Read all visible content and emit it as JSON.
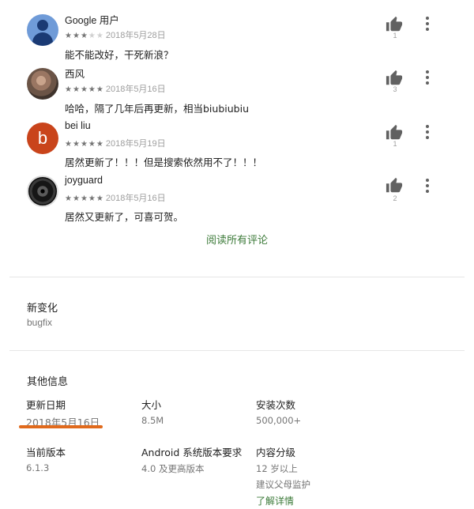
{
  "reviews": [
    {
      "name": "Google 用户",
      "stars": 3,
      "date": "2018年5月28日",
      "text": "能不能改好，干死新浪？",
      "likes": "1"
    },
    {
      "name": "西风",
      "stars": 5,
      "date": "2018年5月16日",
      "text": "哈哈，隔了几年后再更新，相当biubiubiu",
      "likes": "3"
    },
    {
      "name": "bei liu",
      "avatar_letter": "b",
      "stars": 5,
      "date": "2018年5月19日",
      "text": "居然更新了！！！但是搜索依然用不了！！！",
      "likes": "1"
    },
    {
      "name": "joyguard",
      "stars": 5,
      "date": "2018年5月16日",
      "text": "居然又更新了，可喜可贺。",
      "likes": "2"
    }
  ],
  "read_all_label": "阅读所有评论",
  "whats_new": {
    "title": "新变化",
    "text": "bugfix"
  },
  "additional_info": {
    "title": "其他信息",
    "updated": {
      "label": "更新日期",
      "value": "2018年5月16日"
    },
    "size": {
      "label": "大小",
      "value": "8.5M"
    },
    "installs": {
      "label": "安装次数",
      "value": "500,000+"
    },
    "current_version": {
      "label": "当前版本",
      "value": "6.1.3"
    },
    "requires_android": {
      "label": "Android 系统版本要求",
      "value": "4.0 及更高版本"
    },
    "content_rating": {
      "label": "内容分级",
      "value": "12 岁以上",
      "value2": "建议父母监护",
      "link": "了解详情"
    }
  },
  "colors": {
    "link_green": "#3d7b3a",
    "highlight_underline": "#e06a1d",
    "star_filled": "#757575",
    "star_empty": "#d0d0d0"
  }
}
